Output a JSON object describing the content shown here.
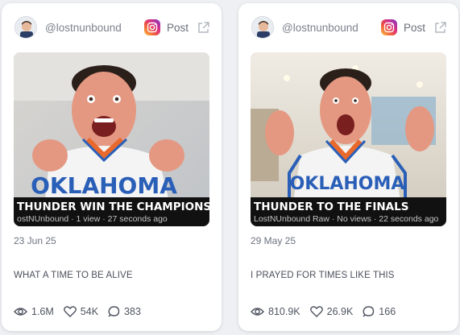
{
  "posts": [
    {
      "handle": "@lostnunbound",
      "platform_icon": "instagram-icon",
      "post_label": "Post",
      "thumbnail": {
        "title": "THUNDER WIN THE CHAMPIONSHI",
        "subtitle": "ostNUnbound · 1 view · 27 seconds ago",
        "jersey_text": "OKLAHOMA"
      },
      "date": "23 Jun 25",
      "caption": "WHAT A TIME TO BE ALIVE",
      "stats": {
        "views": "1.6M",
        "likes": "54K",
        "comments": "383"
      }
    },
    {
      "handle": "@lostnunbound",
      "platform_icon": "instagram-icon",
      "post_label": "Post",
      "thumbnail": {
        "title": "THUNDER TO THE FINALS",
        "subtitle": "LostNUnbound Raw · No views · 22 seconds ago",
        "jersey_text": "OKLAHOMA"
      },
      "date": "29 May 25",
      "caption": "I PRAYED FOR TIMES LIKE THIS",
      "stats": {
        "views": "810.9K",
        "likes": "26.9K",
        "comments": "166"
      }
    }
  ],
  "colors": {
    "card_bg": "#ffffff",
    "page_bg": "#eef0f3",
    "text_muted": "#7d828c",
    "jersey_orange": "#e9692c",
    "jersey_blue": "#2a5fb8"
  }
}
